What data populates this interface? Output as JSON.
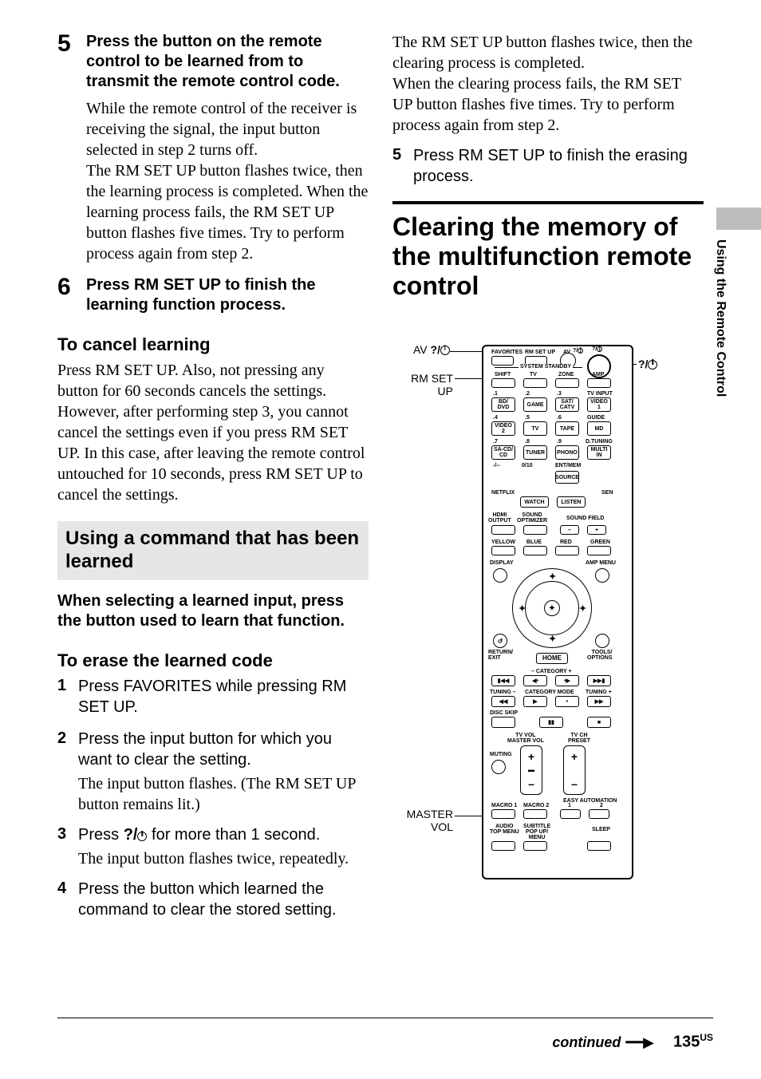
{
  "left": {
    "step5_num": "5",
    "step5_head": "Press the button on the remote control to be learned from to transmit the remote control code.",
    "step5_body": "While the remote control of the receiver is receiving the signal, the input button selected in step 2 turns off.\nThe RM SET UP button flashes twice, then the learning process is completed. When the learning process fails, the RM SET UP button flashes five times. Try to perform process again from step 2.",
    "step6_num": "6",
    "step6_head": "Press RM SET UP to finish the learning function process.",
    "cancel_head": "To cancel learning",
    "cancel_body": "Press RM SET UP. Also, not pressing any button for 60 seconds cancels the settings. However, after performing step 3, you cannot cancel the settings even if you press RM SET UP. In this case, after leaving the remote control untouched for 10 seconds, press RM SET UP to cancel the settings.",
    "bar_head": "Using a command that has been learned",
    "instr": "When selecting a learned input, press the button used to learn that function.",
    "erase_head": "To erase the learned code",
    "e1_num": "1",
    "e1_txt": "Press FAVORITES while pressing RM SET UP.",
    "e2_num": "2",
    "e2_txt": "Press the input button for which you want to clear the setting.",
    "e2_note": "The input button flashes. (The RM SET UP button remains lit.)",
    "e3_num": "3",
    "e3_txt_a": "Press ",
    "e3_txt_b": " for more than 1 second.",
    "e3_note": "The input button flashes twice, repeatedly.",
    "e4_num": "4",
    "e4_txt": "Press the button which learned the command to clear the stored setting."
  },
  "right": {
    "top_para": "The RM SET UP button flashes twice, then the clearing process is completed.\nWhen the clearing process fails, the RM SET UP button flashes five times. Try to perform process again from step 2.",
    "s5_num": "5",
    "s5_txt": "Press RM SET UP to finish the erasing process.",
    "h1": "Clearing the memory of the multifunction remote control"
  },
  "remote": {
    "callouts": {
      "av_power": "AV ",
      "rm_set_up": "RM SET\nUP",
      "power": "",
      "master_vol": "MASTER\nVOL"
    },
    "top_row": {
      "favorites": "FAVORITES",
      "rmsetup": "RM SET UP",
      "av": "AV"
    },
    "row2": {
      "shift": "SHIFT",
      "tv": "TV",
      "zone": "ZONE",
      "amp": "AMP",
      "system_standby": "SYSTEM STANDBY"
    },
    "numgrid": {
      "labels": [
        ".1",
        ".2",
        ".3",
        "TV INPUT",
        ".4",
        ".5",
        ".6",
        "GUIDE",
        ".7",
        ".8",
        ".9",
        "D.TUNING",
        "-/--",
        "0/10",
        "ENT/MEM"
      ],
      "cells": [
        "BD/\nDVD",
        "GAME",
        "SAT/\nCATV",
        "VIDEO\n1",
        "VIDEO\n2",
        "TV",
        "TAPE",
        "MD",
        "SA-CD/\nCD",
        "TUNER",
        "PHONO",
        "MULTI\nIN",
        "",
        "",
        "SOURCE"
      ]
    },
    "mid": {
      "netflix": "NETFLIX",
      "watch": "WATCH",
      "listen": "LISTEN",
      "sen": "SEN",
      "hdmi": "HDMI\nOUTPUT",
      "optimizer": "SOUND\nOPTIMIZER",
      "soundfield": "SOUND FIELD",
      "yellow": "YELLOW",
      "blue": "BLUE",
      "red": "RED",
      "green": "GREEN",
      "display": "DISPLAY",
      "ampmenu": "AMP MENU",
      "return": "RETURN/\nEXIT",
      "tools": "TOOLS/\nOPTIONS",
      "home": "HOME"
    },
    "transport": {
      "catminus": "– CATEGORY +",
      "tuningminus": "TUNING –",
      "catmode": "CATEGORY MODE",
      "tuningplus": "TUNING +",
      "discskip": "DISC SKIP"
    },
    "bottom": {
      "tvvol": "TV VOL\nMASTER VOL",
      "tvch": "TV CH\nPRESET",
      "muting": "MUTING",
      "macro1": "MACRO 1",
      "macro2": "MACRO 2",
      "easyauto": "EASY AUTOMATION",
      "ea1": "1",
      "ea2": "2",
      "audio": "AUDIO\nTOP MENU",
      "subtitle": "SUBTITLE\nPOP UP/\nMENU",
      "sleep": "SLEEP"
    }
  },
  "side_tab": "Using the Remote Control",
  "footer": {
    "continued": "continued",
    "page": "135",
    "region": "US"
  }
}
